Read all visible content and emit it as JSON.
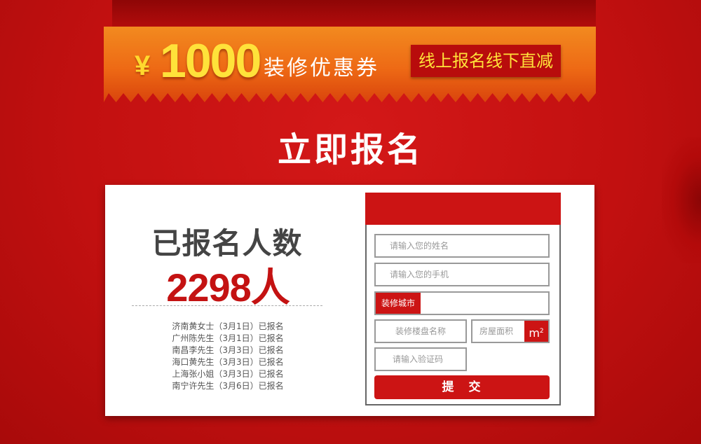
{
  "banner": {
    "currency": "¥",
    "amount": "1000",
    "coupon_text": "装修优惠券",
    "slogan": "线上报名线下直减"
  },
  "title": "立即报名",
  "stats": {
    "label": "已报名人数",
    "value": "2298人"
  },
  "signups": [
    "济南黄女士（3月1日）已报名",
    "广州陈先生（3月1日）已报名",
    "南昌李先生（3月3日）已报名",
    "海口黄先生（3月3日）已报名",
    "上海张小姐（3月3日）已报名",
    "南宁许先生（3月6日）已报名"
  ],
  "form": {
    "name_placeholder": "请输入您的姓名",
    "phone_placeholder": "请输入您的手机",
    "city_label": "装修城市",
    "estate_placeholder": "装修楼盘名称",
    "area_placeholder": "房屋面积",
    "area_unit": "m",
    "area_unit_sup": "2",
    "code_placeholder": "请输入验证码",
    "submit_label": "提　交"
  },
  "colors": {
    "background": "#c21010",
    "accent_red": "#cc1414",
    "banner_orange": "#ee6a15",
    "gold": "#ffe23a"
  }
}
